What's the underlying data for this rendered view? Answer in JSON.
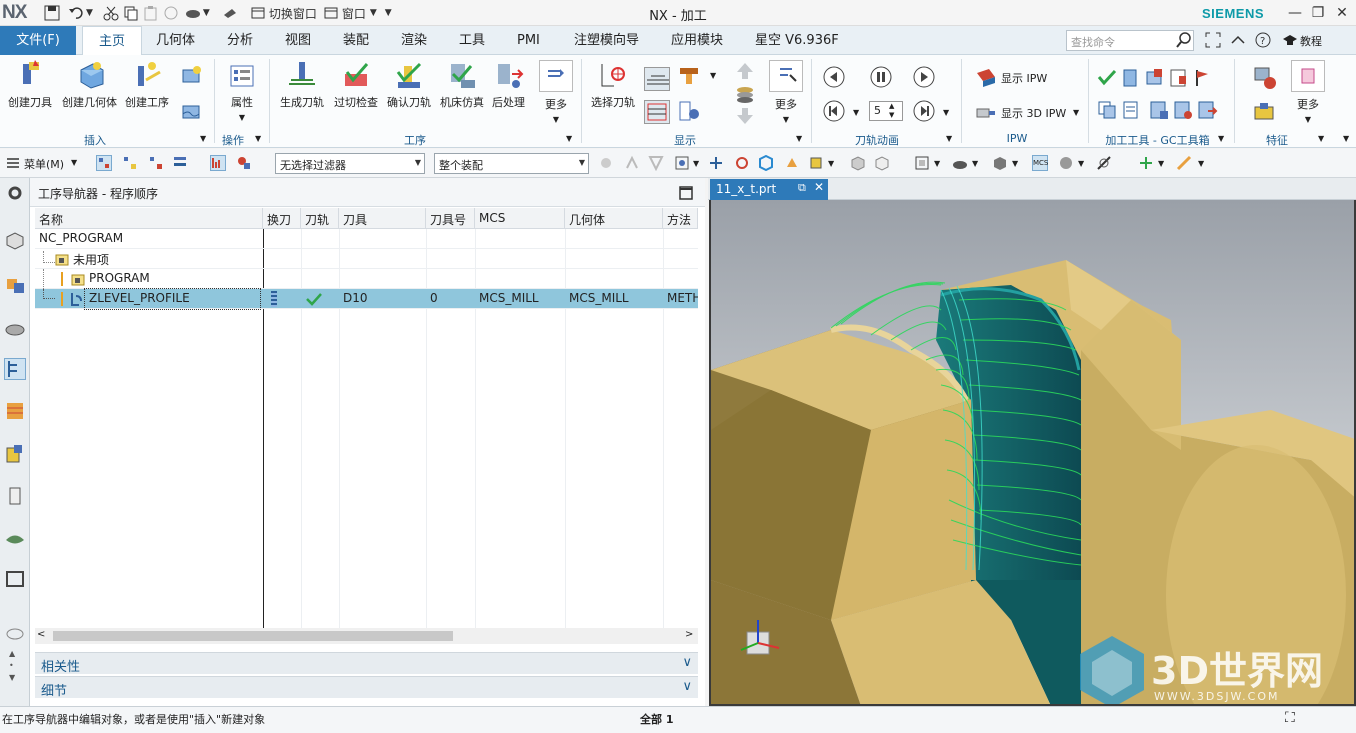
{
  "app": {
    "logo": "NX",
    "title": "NX - 加工",
    "brand": "SIEMENS",
    "switch_window": "切换窗口",
    "window_menu": "窗口"
  },
  "ribbon_tabs": [
    {
      "label": "文件(F)"
    },
    {
      "label": "主页"
    },
    {
      "label": "几何体"
    },
    {
      "label": "分析"
    },
    {
      "label": "视图"
    },
    {
      "label": "装配"
    },
    {
      "label": "渲染"
    },
    {
      "label": "工具"
    },
    {
      "label": "PMI"
    },
    {
      "label": "注塑模向导"
    },
    {
      "label": "应用模块"
    },
    {
      "label": "星空 V6.936F"
    }
  ],
  "search": {
    "placeholder": "查找命令"
  },
  "tutorial_label": "教程",
  "ribbon": {
    "insert": {
      "create_tool": "创建刀具",
      "create_geometry": "创建几何体",
      "create_operation": "创建工序",
      "group": "插入"
    },
    "actions": {
      "properties": "属性",
      "group": "操作"
    },
    "operations": {
      "generate": "生成刀轨",
      "gouge_check": "过切检查",
      "verify": "确认刀轨",
      "simulate": "机床仿真",
      "postprocess": "后处理",
      "more": "更多",
      "group": "工序"
    },
    "display": {
      "select_toolpath": "选择刀轨",
      "more": "更多",
      "group": "显示"
    },
    "animation": {
      "speed": "5",
      "group": "刀轨动画"
    },
    "ipw": {
      "show_ipw": "显示 IPW",
      "show_3d_ipw": "显示 3D IPW",
      "group": "IPW"
    },
    "gc": {
      "group": "加工工具 - GC工具箱"
    },
    "features": {
      "more": "更多",
      "group": "特征"
    }
  },
  "toolbar2": {
    "menu": "菜单(M)",
    "filter": "无选择过滤器",
    "assembly": "整个装配"
  },
  "navigator": {
    "title": "工序导航器 - 程序顺序",
    "columns": [
      "名称",
      "换刀",
      "刀轨",
      "刀具",
      "刀具号",
      "MCS",
      "几何体",
      "方法"
    ],
    "rows": [
      {
        "name": "NC_PROGRAM",
        "tool_change": "",
        "path": "",
        "tool": "",
        "tool_no": "",
        "mcs": "",
        "geometry": "",
        "method": ""
      },
      {
        "name": "未用项",
        "tool_change": "",
        "path": "",
        "tool": "",
        "tool_no": "",
        "mcs": "",
        "geometry": "",
        "method": ""
      },
      {
        "name": "PROGRAM",
        "tool_change": "",
        "path": "",
        "tool": "",
        "tool_no": "",
        "mcs": "",
        "geometry": "",
        "method": ""
      },
      {
        "name": "ZLEVEL_PROFILE",
        "tool_change": "",
        "path": "",
        "tool": "D10",
        "tool_no": "0",
        "mcs": "MCS_MILL",
        "geometry": "MCS_MILL",
        "method": "METH"
      }
    ],
    "dependencies": "相关性",
    "details": "细节"
  },
  "viewport": {
    "file_tab": "11_x_t.prt"
  },
  "watermark": {
    "text": "3D世界网",
    "url": "WWW.3DSJW.COM"
  },
  "status": {
    "message": "在工序导航器中编辑对象，或者是使用\"插入\"新建对象",
    "count": "全部 1"
  },
  "colors": {
    "accent": "#2e7ab9",
    "selection": "#8fc6dc",
    "part": "#d9c07a",
    "teal": "#0f5a5e",
    "toolpath": "#2bd85b"
  }
}
